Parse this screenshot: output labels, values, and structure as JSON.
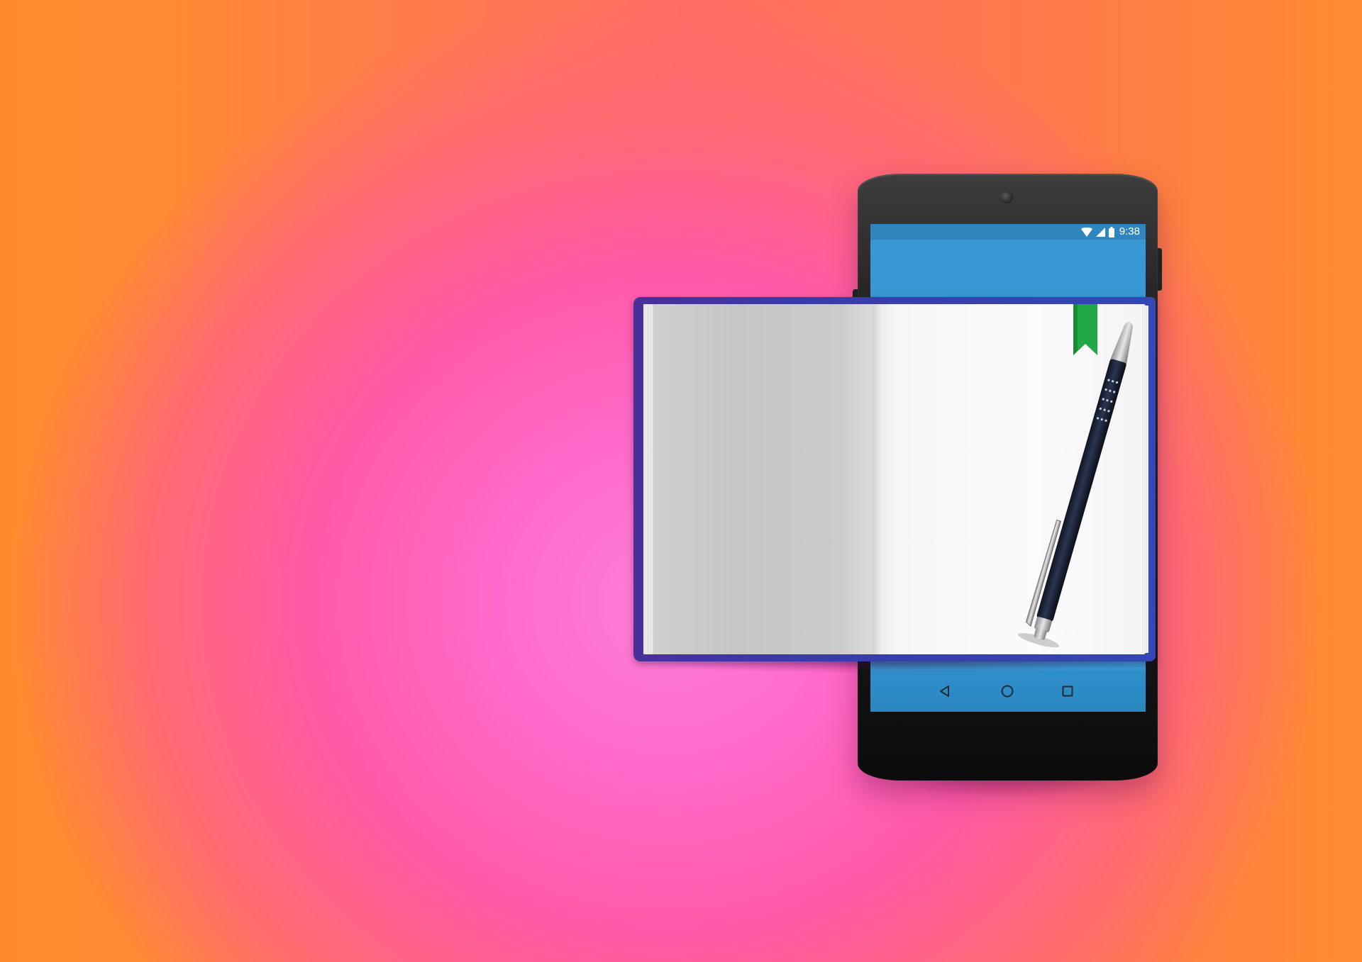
{
  "status_bar": {
    "time": "9:38",
    "icons": [
      "wifi-icon",
      "cellular-signal-icon",
      "battery-icon"
    ]
  },
  "nav_bar": {
    "buttons": [
      "back-triangle-icon",
      "home-circle-icon",
      "recents-square-icon"
    ]
  },
  "scene": {
    "objects": [
      "smartphone",
      "open-notebook",
      "green-bookmark-ribbon",
      "ballpoint-pen"
    ]
  },
  "colors": {
    "background_orange": "#ff8a2e",
    "background_pink": "#ff6bcb",
    "screen_blue": "#3898d3",
    "notebook_cover": "#3a3aa8",
    "bookmark_green": "#1fa843",
    "pen_body": "#1c2436"
  }
}
